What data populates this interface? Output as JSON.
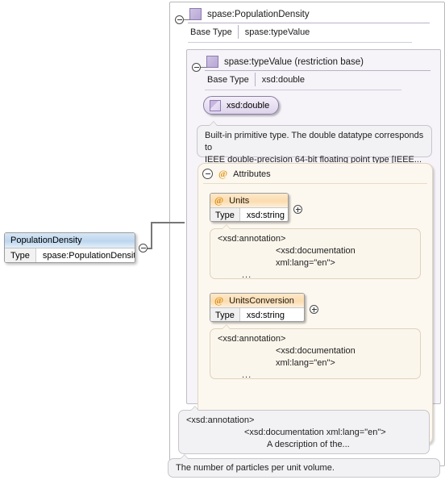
{
  "diagram": {
    "type": "xml-schema-documentation-diagram",
    "root_element": {
      "name": "PopulationDensity",
      "type_key": "Type",
      "type_value": "spase:PopulationDensity",
      "collapse_icon": "minus-circle-icon"
    },
    "complex_type": {
      "title": "spase:PopulationDensity",
      "base_type_key": "Base Type",
      "base_type_value": "spase:typeValue",
      "collapse_icon": "minus-circle-icon",
      "type_icon": "complex-type-square-icon"
    },
    "restriction_type": {
      "title": "spase:typeValue (restriction base)",
      "base_type_key": "Base Type",
      "base_type_value": "xsd:double",
      "collapse_icon": "minus-circle-icon",
      "type_icon": "complex-type-square-icon"
    },
    "simple_type_pill": {
      "label": "xsd:double",
      "icon": "simple-type-triangle-icon"
    },
    "builtin_doc": {
      "line1": "Built-in primitive type. The double datatype corresponds to",
      "line2": "IEEE double-precision 64-bit floating point type [IEEE..."
    },
    "attributes_group": {
      "label": "Attributes",
      "at_symbol": "@",
      "collapse_icon": "minus-circle-icon",
      "attributes": [
        {
          "name": "Units",
          "at_symbol": "@",
          "type_key": "Type",
          "type_value": "xsd:string",
          "expand_icon": "plus-circle-icon",
          "annotation": {
            "line1": "<xsd:annotation>",
            "line2": "<xsd:documentation xml:lang=\"en\">",
            "line3": "..."
          }
        },
        {
          "name": "UnitsConversion",
          "at_symbol": "@",
          "type_key": "Type",
          "type_value": "xsd:string",
          "expand_icon": "plus-circle-icon",
          "annotation": {
            "line1": "<xsd:annotation>",
            "line2": "<xsd:documentation xml:lang=\"en\">",
            "line3": "..."
          }
        }
      ]
    },
    "type_annotation": {
      "line1": "<xsd:annotation>",
      "line2": "<xsd:documentation xml:lang=\"en\">",
      "line3": "A description of the..."
    },
    "element_tooltip": {
      "text": "The number of particles per unit volume."
    }
  },
  "colors": {
    "complex_type_icon": "#b7a6d4",
    "attribute_header": "#fbdcae",
    "element_header": "#bcd6ee",
    "attributes_panel_bg": "#fdf8ef",
    "inner_panel_bg": "#f6f3f9",
    "panel_border": "#b8b8b8",
    "connector": "#777777"
  }
}
